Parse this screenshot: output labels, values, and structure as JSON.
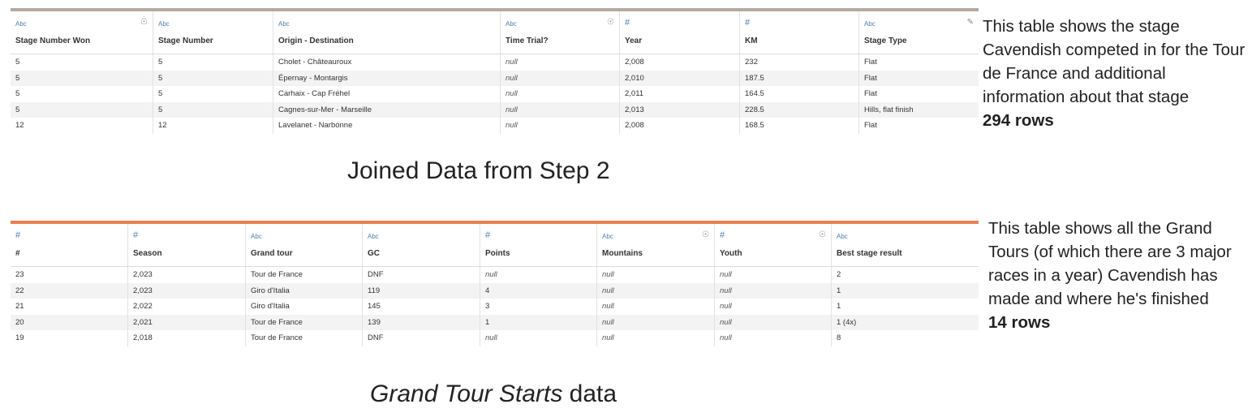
{
  "table1": {
    "bar_color": "#b5aaa0",
    "columns": [
      {
        "type": "Abc",
        "name": "Stage Number Won",
        "icon": "lightbulb-icon",
        "width": 176
      },
      {
        "type": "Abc",
        "name": "Stage Number",
        "icon": "",
        "width": 148
      },
      {
        "type": "Abc",
        "name": "Origin - Destination",
        "icon": "",
        "width": 280
      },
      {
        "type": "Abc",
        "name": "Time Trial?",
        "icon": "lightbulb-icon",
        "width": 147
      },
      {
        "type": "#",
        "name": "Year",
        "icon": "",
        "width": 148
      },
      {
        "type": "#",
        "name": "KM",
        "icon": "",
        "width": 147
      },
      {
        "type": "Abc",
        "name": "Stage Type",
        "icon": "edit-icon",
        "width": 147
      }
    ],
    "rows": [
      [
        "5",
        "5",
        "Cholet - Châteauroux",
        "null",
        "2,008",
        "232",
        "Flat"
      ],
      [
        "5",
        "5",
        "Épernay - Montargis",
        "null",
        "2,010",
        "187.5",
        "Flat"
      ],
      [
        "5",
        "5",
        "Carhaix - Cap Fréhel",
        "null",
        "2,011",
        "164.5",
        "Flat"
      ],
      [
        "5",
        "5",
        "Cagnes-sur-Mer - Marseille",
        "null",
        "2,013",
        "228.5",
        "Hills, flat finish"
      ],
      [
        "12",
        "12",
        "Lavelanet - Narbonne",
        "null",
        "2,008",
        "168.5",
        "Flat"
      ]
    ]
  },
  "note1": {
    "text": "This table shows the stage Cavendish competed in for the Tour de France and additional information about that stage",
    "rows": "294 rows"
  },
  "caption1": "Joined Data from Step 2",
  "table2": {
    "bar_color": "#e8804f",
    "columns": [
      {
        "type": "#",
        "name": "#",
        "icon": "",
        "width": 145
      },
      {
        "type": "#",
        "name": "Season",
        "icon": "",
        "width": 145
      },
      {
        "type": "Abc",
        "name": "Grand tour",
        "icon": "",
        "width": 144
      },
      {
        "type": "Abc",
        "name": "GC",
        "icon": "",
        "width": 145
      },
      {
        "type": "#",
        "name": "Points",
        "icon": "",
        "width": 144
      },
      {
        "type": "Abc",
        "name": "Mountains",
        "icon": "lightbulb-icon",
        "width": 145
      },
      {
        "type": "#",
        "name": "Youth",
        "icon": "lightbulb-icon",
        "width": 144
      },
      {
        "type": "Abc",
        "name": "Best stage result",
        "icon": "",
        "width": 181
      }
    ],
    "rows": [
      [
        "23",
        "2,023",
        "Tour de France",
        "DNF",
        "null",
        "null",
        "null",
        "2"
      ],
      [
        "22",
        "2,023",
        "Giro d'Italia",
        "119",
        "4",
        "null",
        "null",
        "1"
      ],
      [
        "21",
        "2,022",
        "Giro d'Italia",
        "145",
        "3",
        "null",
        "null",
        "1"
      ],
      [
        "20",
        "2,021",
        "Tour de France",
        "139",
        "1",
        "null",
        "null",
        "1 (4x)"
      ],
      [
        "19",
        "2,018",
        "Tour de France",
        "DNF",
        "null",
        "null",
        "null",
        "8"
      ]
    ]
  },
  "note2": {
    "text": "This table shows all the Grand Tours (of which there are 3 major races in a year) Cavendish has made and where he's finished",
    "rows": "14 rows"
  },
  "caption2": {
    "italic": "Grand Tour Starts",
    "rest": " data"
  }
}
